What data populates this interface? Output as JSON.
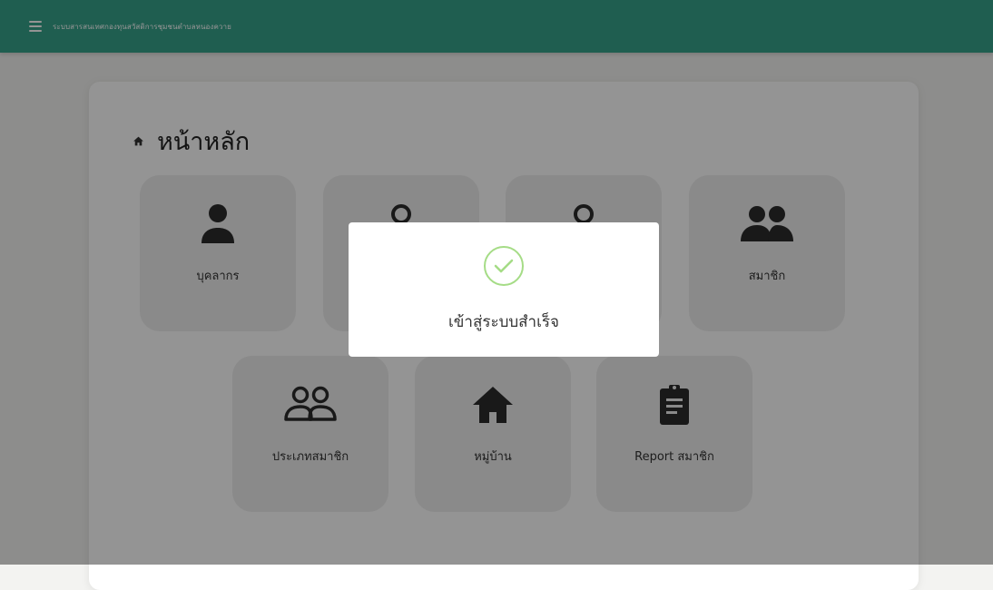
{
  "header": {
    "title": "ระบบสารสนเทศกองทุนสวัสดิการชุมชนตำบลหนองควาย",
    "menu_icon": "hamburger-menu-icon",
    "color": "#36a38b"
  },
  "main": {
    "title": "หน้าหลัก",
    "title_icon": "home-icon",
    "tiles": [
      {
        "label": "บุคลากร",
        "icon": "person-icon"
      },
      {
        "label": "",
        "icon": "map-pin-icon"
      },
      {
        "label": "",
        "icon": "map-pin-icon"
      },
      {
        "label": "สมาชิก",
        "icon": "people-icon"
      },
      {
        "label": "ประเภทสมาชิก",
        "icon": "people-outline-icon"
      },
      {
        "label": "หมู่บ้าน",
        "icon": "house-icon"
      },
      {
        "label": "Report สมาชิก",
        "icon": "clipboard-icon"
      }
    ]
  },
  "modal": {
    "message": "เข้าสู่ระบบสำเร็จ",
    "icon": "success-check-icon",
    "accent": "#a5dc86"
  }
}
